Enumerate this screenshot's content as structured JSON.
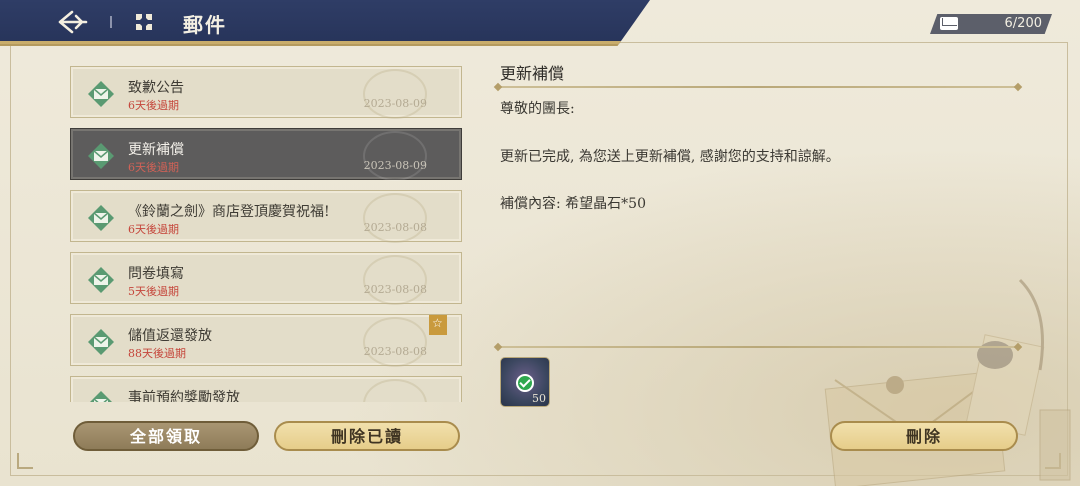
{
  "header": {
    "title": "郵件",
    "mail_count": "6/200"
  },
  "mail_list": [
    {
      "title": "致歉公告",
      "expire": "6天後過期",
      "date": "2023-08-09",
      "selected": false,
      "starred": false
    },
    {
      "title": "更新補償",
      "expire": "6天後過期",
      "date": "2023-08-09",
      "selected": true,
      "starred": false
    },
    {
      "title": "《鈴蘭之劍》商店登頂慶賀祝福!",
      "expire": "6天後過期",
      "date": "2023-08-08",
      "selected": false,
      "starred": false
    },
    {
      "title": "問卷填寫",
      "expire": "5天後過期",
      "date": "2023-08-08",
      "selected": false,
      "starred": false
    },
    {
      "title": "儲值返還發放",
      "expire": "88天後過期",
      "date": "2023-08-08",
      "selected": false,
      "starred": true
    },
    {
      "title": "事前預約獎勵發放",
      "expire": "",
      "date": "",
      "selected": false,
      "starred": false
    }
  ],
  "detail": {
    "title": "更新補償",
    "greeting": "尊敬的團長:",
    "body": "更新已完成, 為您送上更新補償, 感謝您的支持和諒解。",
    "reward_text": "補償內容: 希望晶石*50",
    "reward_qty": "50"
  },
  "buttons": {
    "claim_all": "全部領取",
    "delete_read": "刪除已讀",
    "delete": "刪除"
  },
  "colors": {
    "header_bg": "#2f3d66",
    "expire_red": "#c5463b",
    "button_gold": "#e6cd8a"
  }
}
